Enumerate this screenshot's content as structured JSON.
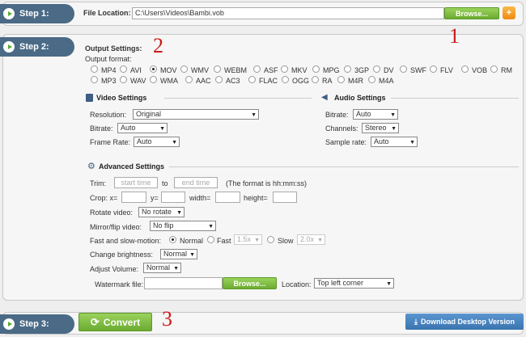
{
  "step1": {
    "label": "Step 1:",
    "file_location_label": "File Location:",
    "file_path": "C:\\Users\\Videos\\Bambi.vob",
    "browse_label": "Browse...",
    "add_label": "+"
  },
  "step2": {
    "label": "Step 2:",
    "output_settings_title": "Output Settings:",
    "output_format_label": "Output format:",
    "formats_row1": [
      "MP4",
      "AVI",
      "MOV",
      "WMV",
      "WEBM",
      "ASF",
      "MKV",
      "MPG",
      "3GP",
      "DV",
      "SWF",
      "FLV",
      "VOB",
      "RM"
    ],
    "formats_row2": [
      "MP3",
      "WAV",
      "WMA",
      "AAC",
      "AC3",
      "FLAC",
      "OGG",
      "RA",
      "M4R",
      "M4A"
    ],
    "selected_format": "MOV",
    "video_settings": {
      "title": "Video Settings",
      "resolution_label": "Resolution:",
      "resolution_value": "Original",
      "bitrate_label": "Bitrate:",
      "bitrate_value": "Auto",
      "framerate_label": "Frame Rate:",
      "framerate_value": "Auto"
    },
    "audio_settings": {
      "title": "Audio Settings",
      "bitrate_label": "Bitrate:",
      "bitrate_value": "Auto",
      "channels_label": "Channels:",
      "channels_value": "Stereo",
      "samplerate_label": "Sample rate:",
      "samplerate_value": "Auto"
    },
    "advanced": {
      "title": "Advanced Settings",
      "trim_label": "Trim:",
      "start_placeholder": "start time",
      "to_label": "to",
      "end_placeholder": "end time",
      "format_hint": "(The format is hh:mm:ss)",
      "crop_label": "Crop: x=",
      "y_label": "y=",
      "width_label": "width=",
      "height_label": "height=",
      "rotate_label": "Rotate video:",
      "rotate_value": "No rotate",
      "mirror_label": "Mirror/flip video:",
      "mirror_value": "No flip",
      "motion_label": "Fast and slow-motion:",
      "normal_label": "Normal",
      "fast_label": "Fast",
      "fast_value": "1.5x",
      "slow_label": "Slow",
      "slow_value": "2.0x",
      "brightness_label": "Change brightness:",
      "brightness_value": "Normal",
      "volume_label": "Adjust Volume:",
      "volume_value": "Normal",
      "watermark_label": "Watermark file:",
      "watermark_browse": "Browse...",
      "location_label": "Location:",
      "location_value": "Top left corner"
    }
  },
  "step3": {
    "label": "Step 3:",
    "convert_label": "Convert",
    "download_label": "Download Desktop Version"
  },
  "annotations": {
    "one": "1",
    "two": "2",
    "three": "3"
  },
  "colors": {
    "step_tab": "#4a6a86",
    "green": "#7cbf3f",
    "annotation": "#cc1a1a",
    "download_btn": "#3f7fbf"
  }
}
